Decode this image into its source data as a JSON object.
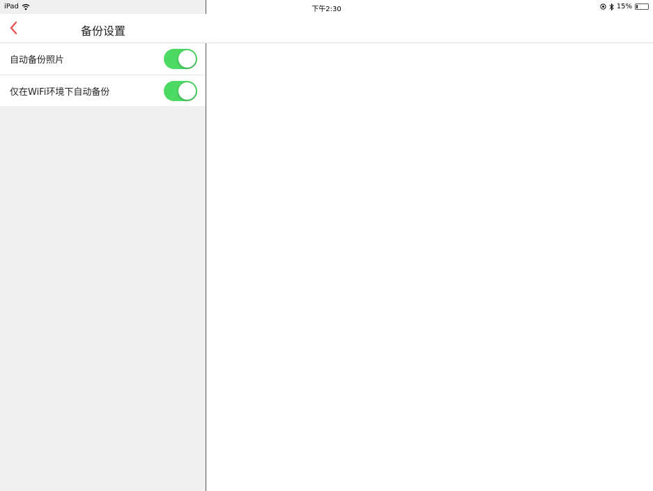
{
  "status_bar": {
    "device": "iPad",
    "time": "下午2:30",
    "battery_text": "15%",
    "battery_level": 0.15,
    "icons": [
      "wifi-icon",
      "location-icon",
      "bluetooth-icon",
      "battery-icon"
    ]
  },
  "left_panel": {
    "title": "备份设置",
    "back_icon": "chevron-left-icon",
    "accent_color": "#e64c4c",
    "settings": [
      {
        "label": "自动备份照片",
        "enabled": true
      },
      {
        "label": "仅在WiFi环境下自动备份",
        "enabled": true
      }
    ]
  },
  "colors": {
    "toggle_on": "#4cd964",
    "sidebar_bg": "#f0f0f0"
  }
}
